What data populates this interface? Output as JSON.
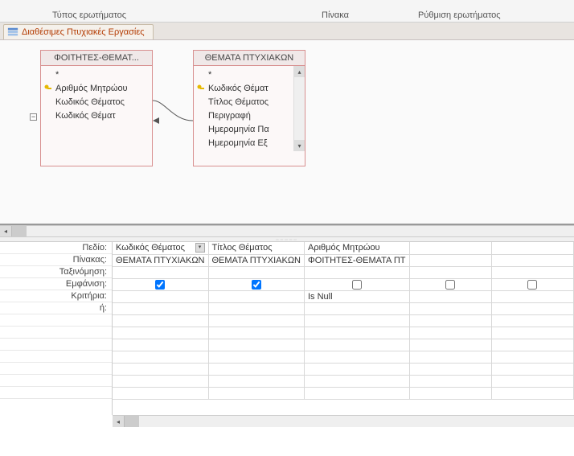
{
  "ribbon": {
    "group1": "Τύπος ερωτήματος",
    "group2": "Πίνακα",
    "group3": "Ρύθμιση ερωτήματος"
  },
  "tab": {
    "title": "Διαθέσιμες Πτυχιακές Εργασίες"
  },
  "tables": {
    "t1": {
      "title": "ΦΟΙΤΗΤΕΣ-ΘΕΜΑΤ...",
      "star": "*",
      "f1": "Αριθμός Μητρώου",
      "f2": "Κωδικός Θέματος",
      "f3": "Κωδικός Θέματ"
    },
    "t2": {
      "title": "ΘΕΜΑΤΑ ΠΤΥΧΙΑΚΩΝ",
      "star": "*",
      "f1": "Κωδικός Θέματ",
      "f2": "Τίτλος Θέματος",
      "f3": "Περιγραφή",
      "f4": "Ημερομηνία Πα",
      "f5": "Ημερομηνία Εξ"
    }
  },
  "labels": {
    "field": "Πεδίο:",
    "table": "Πίνακας:",
    "sort": "Ταξινόμηση:",
    "show": "Εμφάνιση:",
    "criteria": "Κριτήρια:",
    "or": "ή:"
  },
  "grid": {
    "c1": {
      "field": "Κωδικός Θέματος",
      "table": "ΘΕΜΑΤΑ ΠΤΥΧΙΑΚΩΝ",
      "show": true,
      "criteria": ""
    },
    "c2": {
      "field": "Τίτλος Θέματος",
      "table": "ΘΕΜΑΤΑ ΠΤΥΧΙΑΚΩΝ",
      "show": true,
      "criteria": ""
    },
    "c3": {
      "field": "Αριθμός Μητρώου",
      "table": "ΦΟΙΤΗΤΕΣ-ΘΕΜΑΤΑ ΠΤ",
      "show": false,
      "criteria": "Is Null"
    },
    "c4": {
      "field": "",
      "table": "",
      "show": false,
      "criteria": ""
    },
    "c5": {
      "field": "",
      "table": "",
      "show": false,
      "criteria": ""
    }
  }
}
